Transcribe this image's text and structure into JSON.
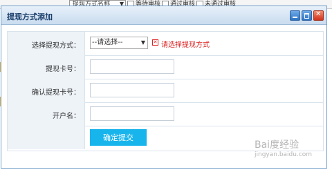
{
  "background": {
    "select_text": "提现方式名称",
    "checks": [
      "等待审核",
      "通过审核",
      "未通过审核"
    ]
  },
  "dialog": {
    "title": "提现方式添加",
    "fields": [
      {
        "label": "选择提现方式：",
        "type": "select",
        "value": "--请选择--",
        "error": "请选择提现方式"
      },
      {
        "label": "提现卡号：",
        "type": "text",
        "value": ""
      },
      {
        "label": "确认提现卡号：",
        "type": "text",
        "value": ""
      },
      {
        "label": "开户名：",
        "type": "text",
        "value": ""
      }
    ],
    "submit_label": "确定提交"
  },
  "watermark": {
    "text": "Bai度经验",
    "sub": "jingyan.baidu.com"
  }
}
